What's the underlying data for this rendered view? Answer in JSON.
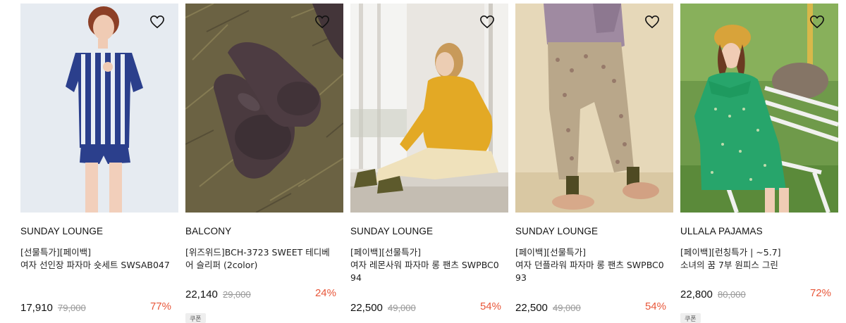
{
  "products": [
    {
      "brand": "SUNDAY LOUNGE",
      "tags": "[선물특가][페이백]",
      "title": "여자 선인장 파자마 숏세트 SWSAB047",
      "price": "17,910",
      "original_price": "79,000",
      "discount": "77%",
      "coupon": "",
      "photo": "striped-pajama-model",
      "wishlist_icon": "heart-outline-icon"
    },
    {
      "brand": "BALCONY",
      "tags": "",
      "title": "[위즈위드]BCH-3723 SWEET 테디베어 슬리퍼 (2color)",
      "price": "22,140",
      "original_price": "29,000",
      "discount": "24%",
      "coupon": "쿠폰",
      "photo": "teddy-slippers-on-grass",
      "wishlist_icon": "heart-outline-icon"
    },
    {
      "brand": "SUNDAY LOUNGE",
      "tags": "[페이백][선물특가]",
      "title": "여자 레몬사워 파자마 롱 팬츠 SWPBC094",
      "price": "22,500",
      "original_price": "49,000",
      "discount": "54%",
      "coupon": "",
      "photo": "yellow-sweater-window-model",
      "wishlist_icon": "heart-outline-icon"
    },
    {
      "brand": "SUNDAY LOUNGE",
      "tags": "[페이백][선물특가]",
      "title": "여자 던플라워 파자마 롱 팬츠 SWPBC093",
      "price": "22,500",
      "original_price": "49,000",
      "discount": "54%",
      "coupon": "",
      "photo": "floral-pants-model",
      "wishlist_icon": "heart-outline-icon"
    },
    {
      "brand": "ULLALA PAJAMAS",
      "tags": "[페이백][런칭특가 | ~5.7]",
      "title": "소녀의 꿈 7부 원피스 그린",
      "price": "22,800",
      "original_price": "80,000",
      "discount": "72%",
      "coupon": "쿠폰",
      "photo": "green-dress-bench-model",
      "wishlist_icon": "heart-outline-icon"
    }
  ],
  "colors": {
    "discount": "#e8573a",
    "strike": "#999999"
  }
}
